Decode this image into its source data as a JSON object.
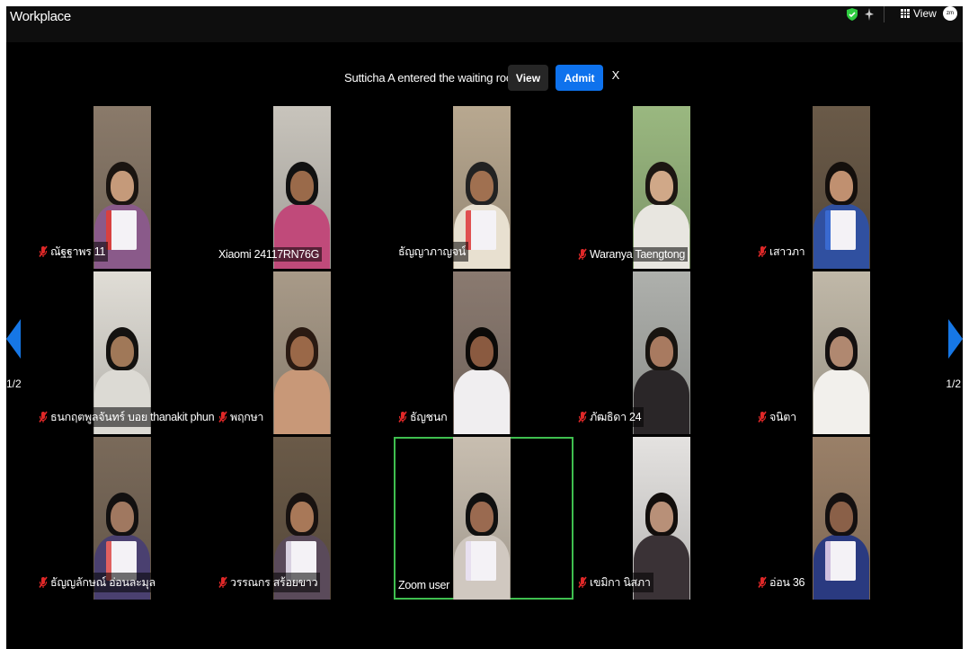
{
  "app": {
    "title": "Workplace",
    "view_label": "View",
    "avatar_text": "zm"
  },
  "colors": {
    "accent": "#0e72ed",
    "active_speaker": "#3fbf4f",
    "muted": "#e02828",
    "nav_arrow": "#1677e6"
  },
  "notification": {
    "text": "Sutticha A entered the waiting room",
    "view_label": "View",
    "admit_label": "Admit",
    "close_label": "X"
  },
  "pagination": {
    "left_label": "1/2",
    "right_label": "1/2"
  },
  "participants": [
    {
      "name": "ณัฐฐาพร 11",
      "muted": true,
      "active": false
    },
    {
      "name": "Xiaomi 24117RN76G",
      "muted": false,
      "active": false
    },
    {
      "name": "ธัญญาภาญจน์",
      "muted": false,
      "active": false
    },
    {
      "name": "Waranya Taengtong",
      "muted": true,
      "active": false
    },
    {
      "name": "เสาวภา",
      "muted": true,
      "active": false
    },
    {
      "name": "ธนกฤตพูลจันทร์ บอย thanakit phunc...",
      "muted": true,
      "active": false
    },
    {
      "name": "พฤกษา",
      "muted": true,
      "active": false
    },
    {
      "name": "ธัญชนก",
      "muted": true,
      "active": false
    },
    {
      "name": "ภัฒธิดา 24",
      "muted": true,
      "active": false
    },
    {
      "name": "จนิตา",
      "muted": true,
      "active": false
    },
    {
      "name": "ธัญญลักษณ์ อ่อนละมุล",
      "muted": true,
      "active": false
    },
    {
      "name": "วรรณกร สร้อยขาว",
      "muted": true,
      "active": false
    },
    {
      "name": "Zoom user",
      "muted": false,
      "active": true
    },
    {
      "name": "เขมิกา นิสภา",
      "muted": true,
      "active": false
    },
    {
      "name": "อ่อน 36",
      "muted": true,
      "active": false
    }
  ]
}
